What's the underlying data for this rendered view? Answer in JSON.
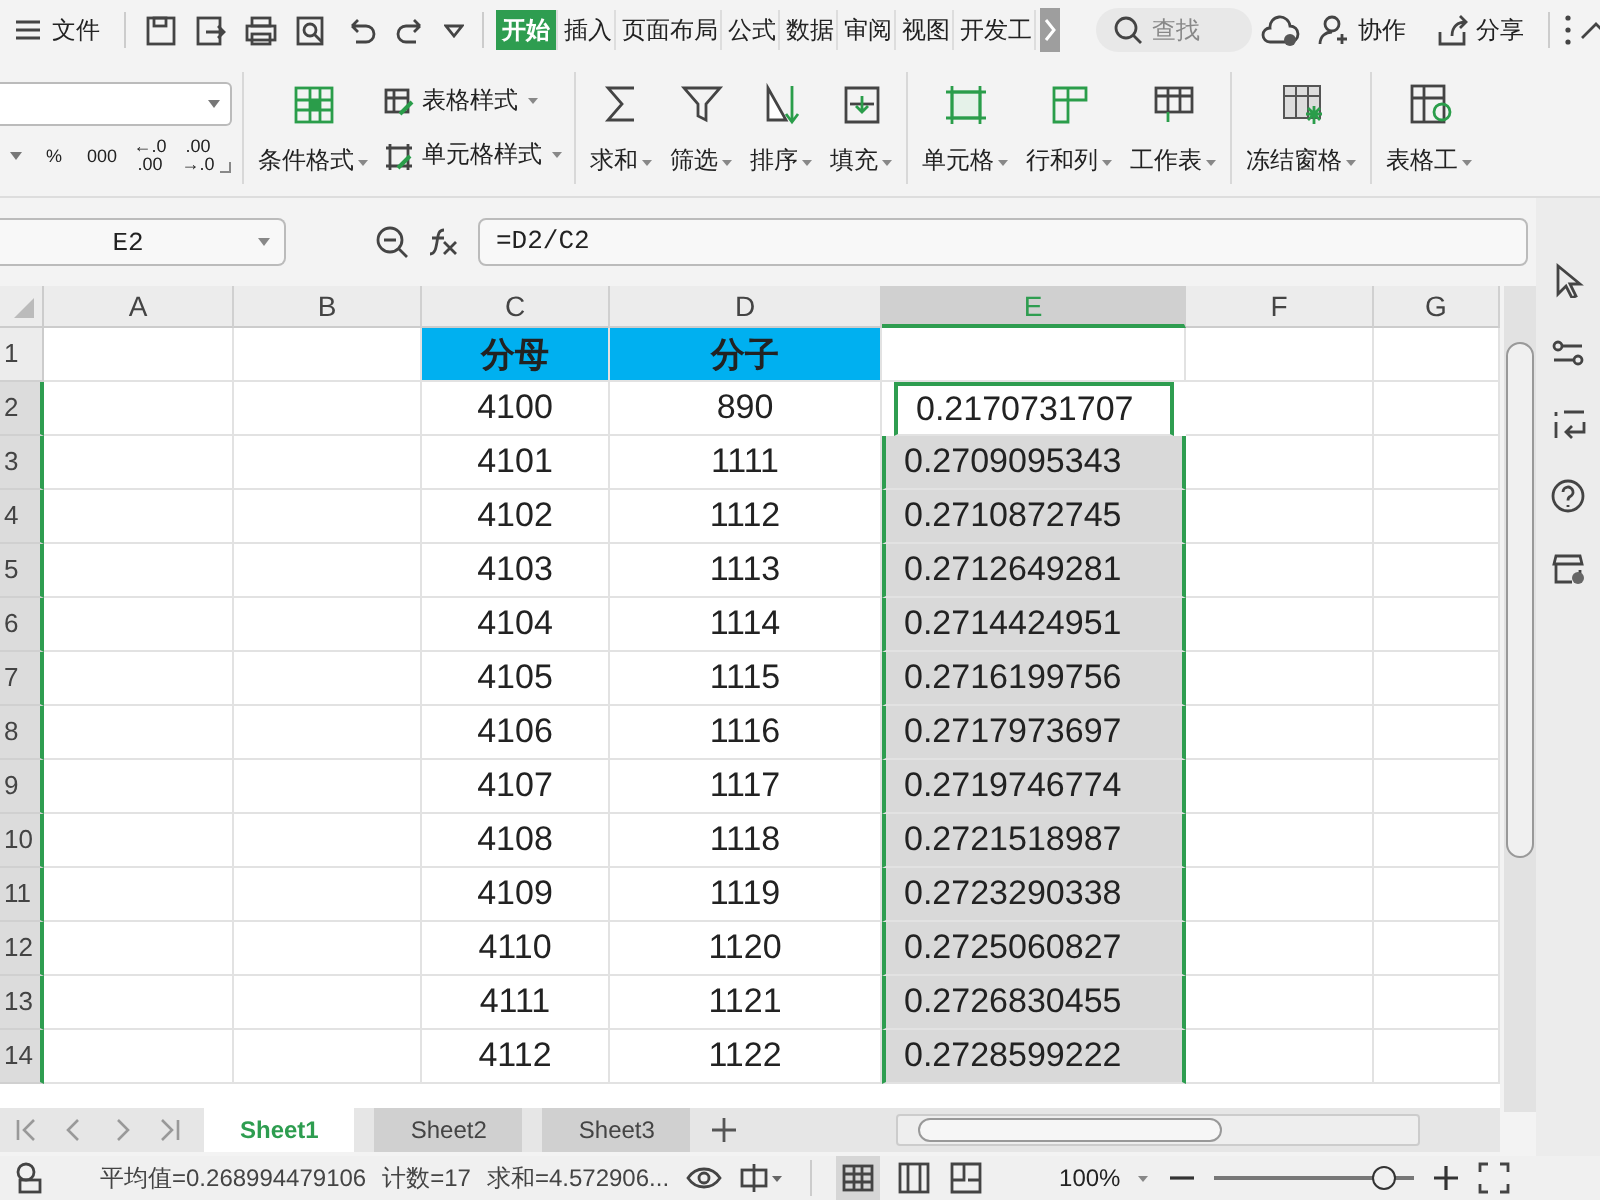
{
  "menu": {
    "label": "文件"
  },
  "tabs": [
    {
      "label": "开始",
      "selected": true
    },
    {
      "label": "插入",
      "selected": false
    },
    {
      "label": "页面布局",
      "selected": false
    },
    {
      "label": "公式",
      "selected": false
    },
    {
      "label": "数据",
      "selected": false
    },
    {
      "label": "审阅",
      "selected": false
    },
    {
      "label": "视图",
      "selected": false
    },
    {
      "label": "开发工",
      "selected": false
    }
  ],
  "search": {
    "placeholder": "查找"
  },
  "actions": [
    "协作",
    "分享"
  ],
  "ribbon": {
    "number_buttons": [
      [
        "%"
      ],
      [
        "000"
      ],
      [
        "←.0",
        ".00"
      ],
      [
        ".00",
        "→.0"
      ]
    ],
    "style_buttons": [
      {
        "label": "条件格式"
      }
    ],
    "small_buttons": [
      {
        "label": "表格样式"
      },
      {
        "label": "单元格样式"
      }
    ],
    "groups": [
      [
        {
          "label": "求和"
        },
        {
          "label": "筛选"
        },
        {
          "label": "排序"
        },
        {
          "label": "填充"
        }
      ],
      [
        {
          "label": "单元格"
        },
        {
          "label": "行和列"
        },
        {
          "label": "工作表"
        }
      ],
      [
        {
          "label": "冻结窗格"
        }
      ],
      [
        {
          "label": "表格工"
        }
      ]
    ]
  },
  "formula_bar": {
    "name_box": "E2",
    "formula": "=D2/C2"
  },
  "columns": [
    {
      "label": "A",
      "selected": false
    },
    {
      "label": "B",
      "selected": false
    },
    {
      "label": "C",
      "selected": false
    },
    {
      "label": "D",
      "selected": false
    },
    {
      "label": "E",
      "selected": true
    },
    {
      "label": "F",
      "selected": false
    },
    {
      "label": "G",
      "selected": false
    }
  ],
  "rows": [
    {
      "number": "1",
      "selected": false,
      "kind": "header",
      "cells": {
        "C": "分母",
        "D": "分子"
      }
    },
    {
      "number": "2",
      "selected": true,
      "kind": "data",
      "cells": {
        "C": "4100",
        "D": "890",
        "E": "0.2170731707"
      }
    },
    {
      "number": "3",
      "selected": true,
      "kind": "data",
      "cells": {
        "C": "4101",
        "D": "1111",
        "E": "0.2709095343"
      }
    },
    {
      "number": "4",
      "selected": true,
      "kind": "data",
      "cells": {
        "C": "4102",
        "D": "1112",
        "E": "0.2710872745"
      }
    },
    {
      "number": "5",
      "selected": true,
      "kind": "data",
      "cells": {
        "C": "4103",
        "D": "1113",
        "E": "0.2712649281"
      }
    },
    {
      "number": "6",
      "selected": true,
      "kind": "data",
      "cells": {
        "C": "4104",
        "D": "1114",
        "E": "0.2714424951"
      }
    },
    {
      "number": "7",
      "selected": true,
      "kind": "data",
      "cells": {
        "C": "4105",
        "D": "1115",
        "E": "0.2716199756"
      }
    },
    {
      "number": "8",
      "selected": true,
      "kind": "data",
      "cells": {
        "C": "4106",
        "D": "1116",
        "E": "0.2717973697"
      }
    },
    {
      "number": "9",
      "selected": true,
      "kind": "data",
      "cells": {
        "C": "4107",
        "D": "1117",
        "E": "0.2719746774"
      }
    },
    {
      "number": "10",
      "selected": true,
      "kind": "data",
      "cells": {
        "C": "4108",
        "D": "1118",
        "E": "0.2721518987"
      }
    },
    {
      "number": "11",
      "selected": true,
      "kind": "data",
      "cells": {
        "C": "4109",
        "D": "1119",
        "E": "0.2723290338"
      }
    },
    {
      "number": "12",
      "selected": true,
      "kind": "data",
      "cells": {
        "C": "4110",
        "D": "1120",
        "E": "0.2725060827"
      }
    },
    {
      "number": "13",
      "selected": true,
      "kind": "data",
      "cells": {
        "C": "4111",
        "D": "1121",
        "E": "0.2726830455"
      }
    },
    {
      "number": "14",
      "selected": true,
      "kind": "data",
      "cells": {
        "C": "4112",
        "D": "1122",
        "E": "0.2728599222"
      }
    }
  ],
  "sheets": [
    {
      "label": "Sheet1",
      "selected": true
    },
    {
      "label": "Sheet2",
      "selected": false
    },
    {
      "label": "Sheet3",
      "selected": false
    }
  ],
  "status_bar": {
    "average": "平均值=0.268994479106",
    "count": "计数=17",
    "sum": "求和=4.572906...",
    "zoom": "100%",
    "zoom_slider": {
      "level": 0.85
    }
  }
}
